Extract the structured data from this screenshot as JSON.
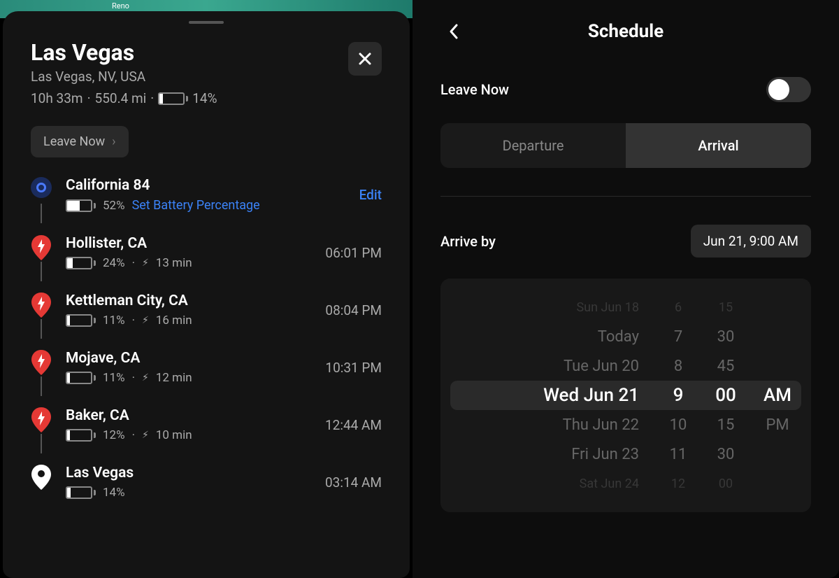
{
  "map": {
    "label_visible": "Reno"
  },
  "trip": {
    "destination": "Las Vegas",
    "destination_full": "Las Vegas, NV, USA",
    "duration": "10h 33m",
    "distance": "550.4 mi",
    "arrival_battery": "14%",
    "leave_now_label": "Leave Now",
    "edit_label": "Edit",
    "stops": [
      {
        "name": "California 84",
        "battery": "52%",
        "fill": 52,
        "action": "Set Battery Percentage",
        "type": "start"
      },
      {
        "name": "Hollister, CA",
        "battery": "24%",
        "fill": 24,
        "charge": "13 min",
        "time": "06:01 PM",
        "type": "charger"
      },
      {
        "name": "Kettleman City, CA",
        "battery": "11%",
        "fill": 11,
        "charge": "16 min",
        "time": "08:04 PM",
        "type": "charger"
      },
      {
        "name": "Mojave, CA",
        "battery": "11%",
        "fill": 11,
        "charge": "12 min",
        "time": "10:31 PM",
        "type": "charger"
      },
      {
        "name": "Baker, CA",
        "battery": "12%",
        "fill": 12,
        "charge": "10 min",
        "time": "12:44 AM",
        "type": "charger"
      },
      {
        "name": "Las Vegas",
        "battery": "14%",
        "fill": 14,
        "time": "03:14 AM",
        "type": "destination"
      }
    ]
  },
  "schedule": {
    "title": "Schedule",
    "leave_now_label": "Leave Now",
    "leave_now_enabled": false,
    "tabs": {
      "departure": "Departure",
      "arrival": "Arrival",
      "active": "arrival"
    },
    "arrive_by_label": "Arrive by",
    "arrive_by_value": "Jun 21, 9:00 AM",
    "picker": {
      "rows": [
        {
          "date": "Sun Jun 18",
          "hr": "6",
          "min": "15",
          "ampm": "",
          "cls": "far"
        },
        {
          "date": "Today",
          "hr": "7",
          "min": "30",
          "ampm": "",
          "cls": ""
        },
        {
          "date": "Tue Jun 20",
          "hr": "8",
          "min": "45",
          "ampm": "",
          "cls": ""
        },
        {
          "date": "Wed Jun 21",
          "hr": "9",
          "min": "00",
          "ampm": "AM",
          "cls": "selected"
        },
        {
          "date": "Thu Jun 22",
          "hr": "10",
          "min": "15",
          "ampm": "PM",
          "cls": ""
        },
        {
          "date": "Fri Jun 23",
          "hr": "11",
          "min": "30",
          "ampm": "",
          "cls": ""
        },
        {
          "date": "Sat Jun 24",
          "hr": "12",
          "min": "00",
          "ampm": "",
          "cls": "far"
        }
      ]
    }
  }
}
